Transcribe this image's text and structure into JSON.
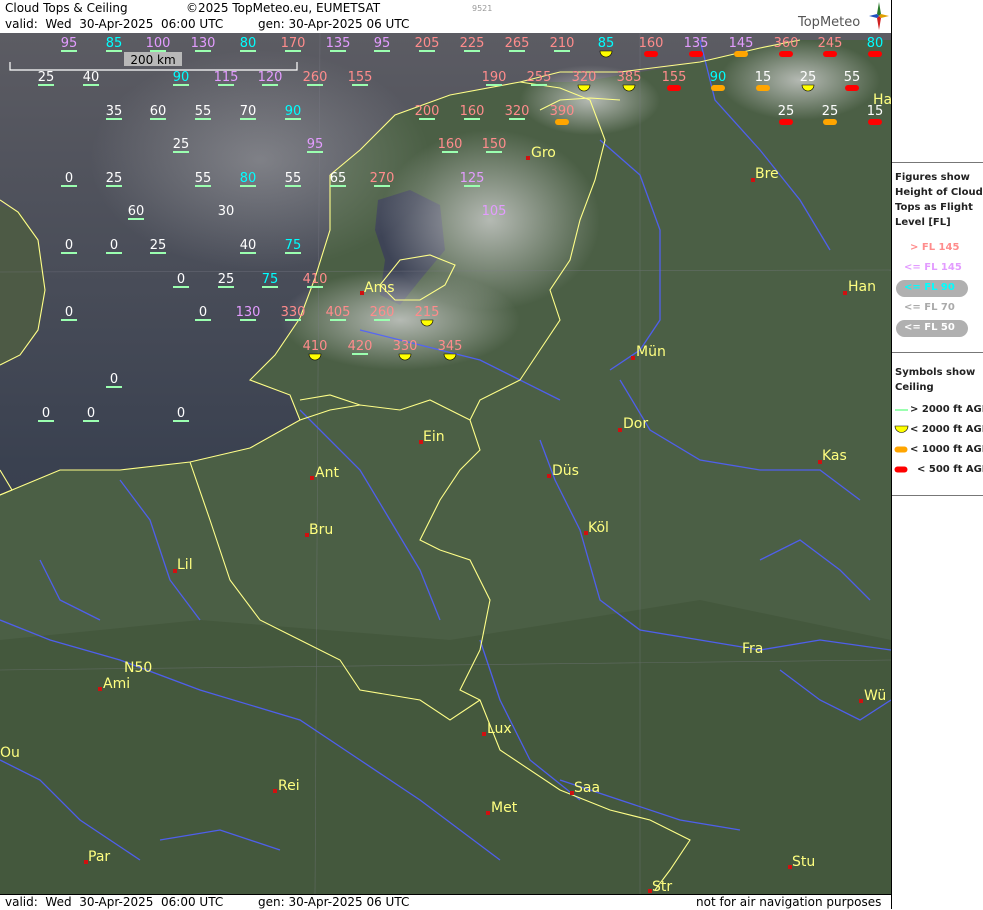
{
  "header": {
    "title": "Cloud Tops & Ceiling",
    "copyright": "©2025 TopMeteo.eu, EUMETSAT",
    "valid": "valid:  Wed  30-Apr-2025  06:00 UTC",
    "gen": "gen: 30-Apr-2025 06 UTC",
    "code": "9521",
    "logo": "TopMeteo"
  },
  "footer": {
    "valid": "valid:  Wed  30-Apr-2025  06:00 UTC",
    "gen": "gen: 30-Apr-2025 06 UTC",
    "note": "not for air navigation purposes"
  },
  "scale_bar": {
    "label": "200 km"
  },
  "legend": {
    "tops_title": [
      "Figures show",
      "Height of Cloud",
      "Tops as Flight",
      "Level  [FL]"
    ],
    "tops_items": [
      {
        "label": "> FL 145",
        "color": "#ff8c8c"
      },
      {
        "label": "<= FL 145",
        "color": "#e39cff"
      },
      {
        "label": "<= FL 90",
        "color": "#00ffff"
      },
      {
        "label": "<= FL 70",
        "color": "#aaaaaa"
      },
      {
        "label": "<= FL 50",
        "color": "#ffffff"
      }
    ],
    "ceiling_title": [
      "Symbols show",
      "Ceiling"
    ],
    "ceiling_items": [
      {
        "label": "> 2000 ft AGL",
        "color": "#9bffb0"
      },
      {
        "label": "< 2000 ft AGL",
        "color": "#ffff00"
      },
      {
        "label": "< 1000 ft AGL",
        "color": "#ffa500"
      },
      {
        "label": "< 500 ft AGL",
        "color": "#ff0000"
      }
    ]
  },
  "colors": {
    "high": "#ff8c8c",
    "mid": "#e39cff",
    "cyan": "#00ffff",
    "low": "#ffffff",
    "city": "#ffff80",
    "border": "#ffff88",
    "river": "#5060ff"
  },
  "cities": [
    "Gro",
    "Bre",
    "Han",
    "Ams",
    "Mün",
    "Dor",
    "Ein",
    "Kas",
    "Ant",
    "Düs",
    "Köl",
    "Bru",
    "Lil",
    "Fra",
    "Ami",
    "N50",
    "Wü",
    "Lux",
    "Rei",
    "Saa",
    "Met",
    "Ou",
    "Par",
    "Stu",
    "Str",
    "Ha"
  ],
  "tops": [
    {
      "v": "95",
      "c": "mid",
      "m": "ok"
    },
    {
      "v": "85",
      "c": "cyan",
      "m": "ok"
    },
    {
      "v": "100",
      "c": "mid",
      "m": "ok"
    },
    {
      "v": "130",
      "c": "mid",
      "m": "ok"
    },
    {
      "v": "80",
      "c": "cyan",
      "m": "ok"
    },
    {
      "v": "170",
      "c": "high",
      "m": "ok"
    },
    {
      "v": "135",
      "c": "mid",
      "m": "ok"
    },
    {
      "v": "95",
      "c": "mid",
      "m": "ok"
    },
    {
      "v": "205",
      "c": "high",
      "m": "ok"
    },
    {
      "v": "225",
      "c": "high",
      "m": "ok"
    },
    {
      "v": "265",
      "c": "high",
      "m": "ok"
    },
    {
      "v": "210",
      "c": "high",
      "m": "ok"
    },
    {
      "v": "85",
      "c": "cyan",
      "m": "yellow"
    },
    {
      "v": "160",
      "c": "high",
      "m": "red"
    },
    {
      "v": "135",
      "c": "mid",
      "m": "red"
    },
    {
      "v": "145",
      "c": "mid",
      "m": "orange"
    },
    {
      "v": "360",
      "c": "high",
      "m": "red"
    },
    {
      "v": "245",
      "c": "high",
      "m": "red"
    },
    {
      "v": "80",
      "c": "cyan",
      "m": "red"
    },
    {
      "v": "25",
      "c": "low",
      "m": "ok"
    },
    {
      "v": "40",
      "c": "low",
      "m": "ok"
    },
    {
      "v": "90",
      "c": "cyan",
      "m": "ok"
    },
    {
      "v": "115",
      "c": "mid",
      "m": "ok"
    },
    {
      "v": "120",
      "c": "mid",
      "m": "ok"
    },
    {
      "v": "260",
      "c": "high",
      "m": "ok"
    },
    {
      "v": "155",
      "c": "high",
      "m": "ok"
    },
    {
      "v": "190",
      "c": "high",
      "m": "ok"
    },
    {
      "v": "255",
      "c": "high",
      "m": "ok"
    },
    {
      "v": "320",
      "c": "high",
      "m": "yellow"
    },
    {
      "v": "385",
      "c": "high",
      "m": "yellow"
    },
    {
      "v": "155",
      "c": "high",
      "m": "red"
    },
    {
      "v": "90",
      "c": "cyan",
      "m": "orange"
    },
    {
      "v": "15",
      "c": "low",
      "m": "orange"
    },
    {
      "v": "25",
      "c": "low",
      "m": "yellow"
    },
    {
      "v": "55",
      "c": "low",
      "m": "red"
    },
    {
      "v": "35",
      "c": "low",
      "m": "ok"
    },
    {
      "v": "60",
      "c": "low",
      "m": "ok"
    },
    {
      "v": "55",
      "c": "low",
      "m": "ok"
    },
    {
      "v": "70",
      "c": "low",
      "m": "ok"
    },
    {
      "v": "90",
      "c": "cyan",
      "m": "ok"
    },
    {
      "v": "200",
      "c": "high",
      "m": "ok"
    },
    {
      "v": "160",
      "c": "high",
      "m": "ok"
    },
    {
      "v": "320",
      "c": "high",
      "m": "ok"
    },
    {
      "v": "390",
      "c": "high",
      "m": "orange"
    },
    {
      "v": "25",
      "c": "low",
      "m": "red"
    },
    {
      "v": "25",
      "c": "low",
      "m": "orange"
    },
    {
      "v": "15",
      "c": "low",
      "m": "red"
    },
    {
      "v": "25",
      "c": "low",
      "m": "ok"
    },
    {
      "v": "95",
      "c": "mid",
      "m": "ok"
    },
    {
      "v": "160",
      "c": "high",
      "m": "ok"
    },
    {
      "v": "150",
      "c": "high",
      "m": "ok"
    },
    {
      "v": "0",
      "c": "low",
      "m": "ok"
    },
    {
      "v": "25",
      "c": "low",
      "m": "ok"
    },
    {
      "v": "55",
      "c": "low",
      "m": "ok"
    },
    {
      "v": "80",
      "c": "cyan",
      "m": "ok"
    },
    {
      "v": "55",
      "c": "low",
      "m": "ok"
    },
    {
      "v": "65",
      "c": "low",
      "m": "ok"
    },
    {
      "v": "270",
      "c": "high",
      "m": "ok"
    },
    {
      "v": "125",
      "c": "mid",
      "m": "ok"
    },
    {
      "v": "60",
      "c": "low",
      "m": "ok"
    },
    {
      "v": "30",
      "c": "low",
      "m": "none"
    },
    {
      "v": "105",
      "c": "mid",
      "m": "none"
    },
    {
      "v": "0",
      "c": "low",
      "m": "ok"
    },
    {
      "v": "0",
      "c": "low",
      "m": "ok"
    },
    {
      "v": "25",
      "c": "low",
      "m": "ok"
    },
    {
      "v": "40",
      "c": "low",
      "m": "ok"
    },
    {
      "v": "75",
      "c": "cyan",
      "m": "ok"
    },
    {
      "v": "0",
      "c": "low",
      "m": "ok"
    },
    {
      "v": "25",
      "c": "low",
      "m": "ok"
    },
    {
      "v": "75",
      "c": "cyan",
      "m": "ok"
    },
    {
      "v": "410",
      "c": "high",
      "m": "ok"
    },
    {
      "v": "0",
      "c": "low",
      "m": "ok"
    },
    {
      "v": "0",
      "c": "low",
      "m": "ok"
    },
    {
      "v": "130",
      "c": "mid",
      "m": "ok"
    },
    {
      "v": "330",
      "c": "high",
      "m": "ok"
    },
    {
      "v": "405",
      "c": "high",
      "m": "ok"
    },
    {
      "v": "260",
      "c": "high",
      "m": "ok"
    },
    {
      "v": "215",
      "c": "high",
      "m": "yellow"
    },
    {
      "v": "410",
      "c": "high",
      "m": "yellow"
    },
    {
      "v": "420",
      "c": "high",
      "m": "ok"
    },
    {
      "v": "330",
      "c": "high",
      "m": "yellow"
    },
    {
      "v": "345",
      "c": "high",
      "m": "yellow"
    },
    {
      "v": "0",
      "c": "low",
      "m": "ok"
    },
    {
      "v": "0",
      "c": "low",
      "m": "ok"
    },
    {
      "v": "0",
      "c": "low",
      "m": "ok"
    },
    {
      "v": "0",
      "c": "low",
      "m": "ok"
    }
  ]
}
